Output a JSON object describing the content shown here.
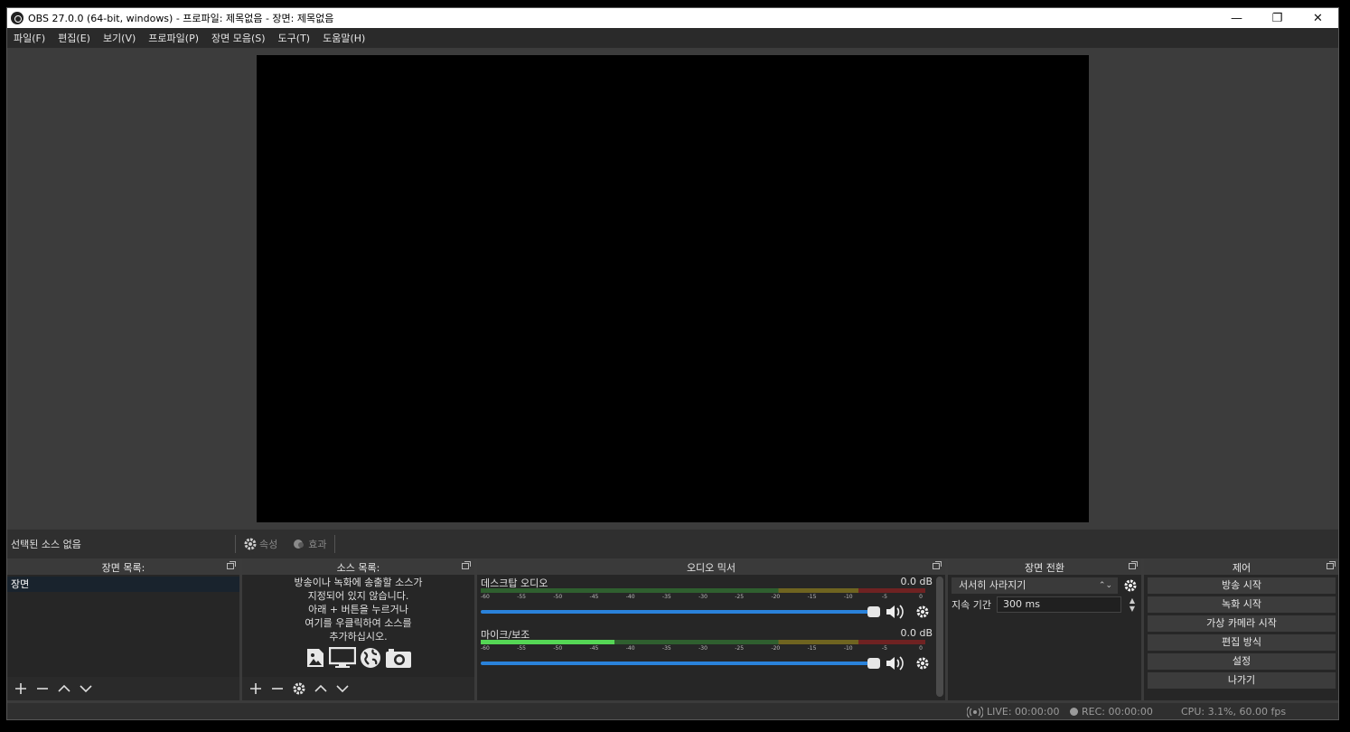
{
  "window": {
    "title": "OBS 27.0.0 (64-bit, windows) - 프로파일: 제목없음 - 장면: 제목없음",
    "minimize": "—",
    "maximize": "❐",
    "close": "✕"
  },
  "menu": [
    "파일(F)",
    "편집(E)",
    "보기(V)",
    "프로파일(P)",
    "장면 모음(S)",
    "도구(T)",
    "도움말(H)"
  ],
  "context_bar": {
    "no_source": "선택된 소스 없음",
    "properties": "속성",
    "filters": "효과"
  },
  "scenes": {
    "header": "장면 목록:",
    "items": [
      "장면"
    ]
  },
  "sources": {
    "header": "소스 목록:",
    "hint_lines": [
      "방송이나 녹화에 송출할 소스가",
      "지정되어 있지 않습니다.",
      "아래 + 버튼을 누르거나",
      "여기를 우클릭하여 소스를",
      "추가하십시오."
    ]
  },
  "mixer": {
    "header": "오디오 믹서",
    "tick_labels": [
      "-60",
      "-55",
      "-50",
      "-45",
      "-40",
      "-35",
      "-30",
      "-25",
      "-20",
      "-15",
      "-10",
      "-5",
      "0"
    ],
    "channels": [
      {
        "name": "데스크탑 오디오",
        "db": "0.0 dB",
        "level": 0.0
      },
      {
        "name": "마이크/보조",
        "db": "0.0 dB",
        "level": 0.3
      }
    ]
  },
  "transitions": {
    "header": "장면 전환",
    "selected": "서서히 사라지기",
    "duration_label": "지속 기간",
    "duration_value": "300 ms"
  },
  "controls": {
    "header": "제어",
    "buttons": [
      "방송 시작",
      "녹화 시작",
      "가상 카메라 시작",
      "편집 방식",
      "설정",
      "나가기"
    ]
  },
  "status": {
    "live": "LIVE: 00:00:00",
    "rec": "REC: 00:00:00",
    "cpu": "CPU: 3.1%, 60.00 fps"
  }
}
